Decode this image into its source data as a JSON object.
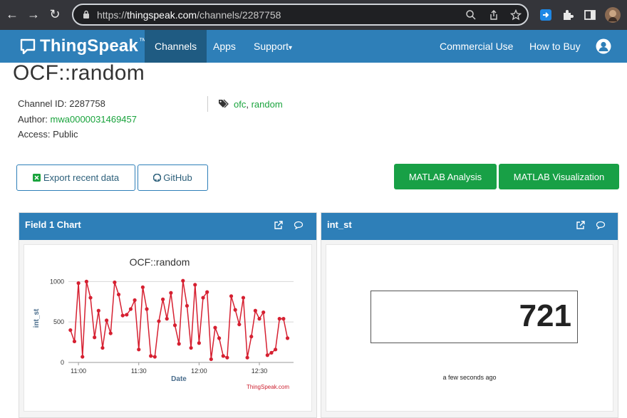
{
  "browser": {
    "url_prefix": "https://",
    "url_host": "thingspeak.com",
    "url_path": "/channels/2287758"
  },
  "navbar": {
    "brand": "ThingSpeak",
    "brand_tm": "™",
    "items": [
      {
        "label": "Channels",
        "active": true
      },
      {
        "label": "Apps",
        "active": false
      },
      {
        "label": "Support",
        "active": false
      }
    ],
    "right_items": [
      {
        "label": "Commercial Use"
      },
      {
        "label": "How to Buy"
      }
    ],
    "support_caret": "▾"
  },
  "channel": {
    "title": "OCF::random",
    "id_label": "Channel ID:",
    "id_value": "2287758",
    "author_label": "Author:",
    "author_value": "mwa0000031469457",
    "access_label": "Access:",
    "access_value": "Public",
    "tags": [
      "ofc",
      "random"
    ],
    "tag_separator": ","
  },
  "buttons": {
    "export": "Export recent data",
    "github": "GitHub",
    "matlab_analysis": "MATLAB Analysis",
    "matlab_visualization": "MATLAB Visualization"
  },
  "panels": {
    "chart_title": "Field 1 Chart",
    "gauge_title": "int_st"
  },
  "gauge": {
    "value": "721",
    "time": "a few seconds ago"
  },
  "colors": {
    "accent": "#2e7fb8",
    "green": "#18a046",
    "series": "#d62031"
  },
  "chart_data": {
    "type": "line",
    "title": "OCF::random",
    "xlabel": "Date",
    "ylabel": "int_st",
    "credit": "ThingSpeak.com",
    "ylim": [
      0,
      1100
    ],
    "yticks": [
      0,
      500,
      1000
    ],
    "xticks": [
      "11:00",
      "11:30",
      "12:00",
      "12:30"
    ],
    "xtick_minutes": [
      0,
      30,
      60,
      90
    ],
    "x_range_minutes": [
      -5,
      107
    ],
    "series": [
      {
        "x_minutes": [
          -4,
          -2,
          0,
          2,
          4,
          6,
          8,
          10,
          12,
          14,
          16,
          18,
          20,
          22,
          24,
          26,
          28,
          30,
          32,
          34,
          36,
          38,
          40,
          42,
          44,
          46,
          48,
          50,
          52,
          54,
          56,
          58,
          60,
          62,
          64,
          66,
          68,
          70,
          72,
          74,
          76,
          78,
          80,
          82,
          84,
          86,
          88,
          90,
          92,
          94,
          96,
          98,
          100,
          102,
          104
        ],
        "values": [
          400,
          260,
          980,
          70,
          1000,
          800,
          310,
          640,
          180,
          520,
          360,
          990,
          840,
          580,
          590,
          660,
          770,
          160,
          930,
          660,
          80,
          70,
          510,
          780,
          540,
          860,
          460,
          230,
          1010,
          700,
          180,
          960,
          240,
          800,
          870,
          40,
          430,
          300,
          80,
          60,
          820,
          650,
          470,
          800,
          60,
          320,
          640,
          540,
          620,
          90,
          120,
          160,
          540,
          540,
          300,
          1020,
          540,
          720
        ]
      }
    ]
  }
}
